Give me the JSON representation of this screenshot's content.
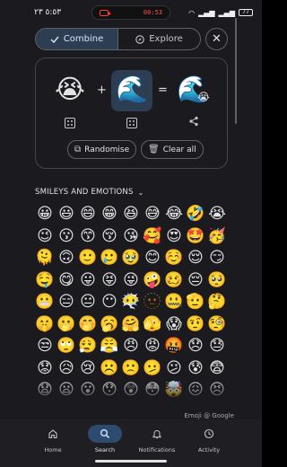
{
  "status": {
    "time": "٥:٥٣ ٢٣",
    "timer": "00:53",
    "battery": "77"
  },
  "mode": {
    "combine_label": "Combine",
    "explore_label": "Explore",
    "close_glyph": "✕"
  },
  "combiner": {
    "left_emoji": "😭",
    "plus": "+",
    "right_emoji": "🌊",
    "equals": "=",
    "result_emoji": "🌊",
    "result_badge": "😭",
    "randomise_label": "Randomise",
    "clear_label": "Clear all"
  },
  "category": {
    "label": "SMILEYS AND EMOTIONS",
    "chevron": "⌄"
  },
  "emoji_grid": [
    "😀",
    "😃",
    "😄",
    "😁",
    "😆",
    "😅",
    "😂",
    "🤣",
    "😭",
    "😉",
    "😗",
    "😙",
    "😚",
    "😘",
    "🥰",
    "😍",
    "🤩",
    "🥳",
    "🫠",
    "🙃",
    "🙂",
    "🥲",
    "🥹",
    "😊",
    "☺️",
    "😌",
    "😏",
    "🤤",
    "😋",
    "😛",
    "😝",
    "😜",
    "🤪",
    "🥴",
    "😔",
    "🥺",
    "😬",
    "😑",
    "😐",
    "😶",
    "😶‍🌫️",
    "🫥",
    "🤐",
    "🫡",
    "🤔",
    "🤫",
    "🫢",
    "🤭",
    "🥱",
    "🤗",
    "🫣",
    "😱",
    "🤨",
    "🧐",
    "😒",
    "🙄",
    "😮‍💨",
    "😤",
    "😠",
    "😡",
    "🤬",
    "😞",
    "😓",
    "😟",
    "😥",
    "😢",
    "☹️",
    "🙁",
    "🫤",
    "😕",
    "😰",
    "😨",
    "😧",
    "😦",
    "😮",
    "😯",
    "😲",
    "😳",
    "🤯",
    "😖",
    "😣"
  ],
  "credit": "Emoji @ Google",
  "nav": {
    "home_label": "Home",
    "search_label": "Search",
    "notifications_label": "Notifications",
    "activity_label": "Activity"
  },
  "icons": {
    "combine": "check-icon",
    "explore": "compass-icon",
    "close": "close-icon",
    "dice": "dice-icon",
    "share": "share-icon",
    "randomise": "shuffle-icon",
    "clear": "trash-icon"
  },
  "colors": {
    "background": "#1b1b1f",
    "accent_container": "#2d3e52",
    "nav_active": "#2d4b6e",
    "outline": "#5f6368"
  }
}
